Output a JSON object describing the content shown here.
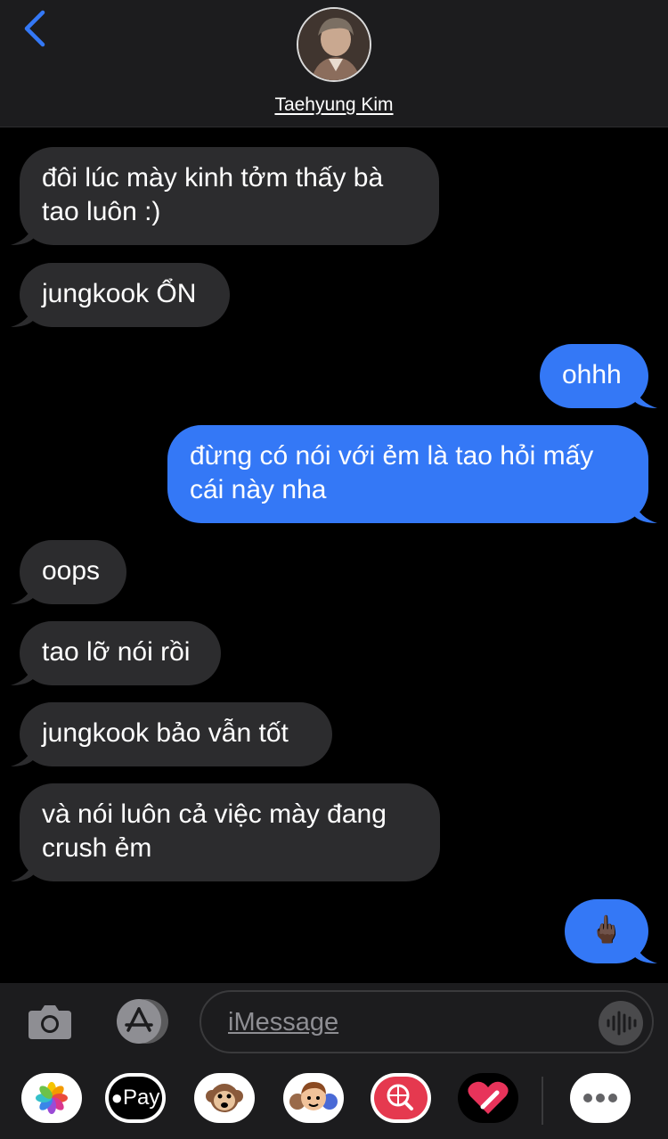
{
  "header": {
    "contact_name": "Taehyung Kim"
  },
  "messages": [
    {
      "from": "them",
      "text": "đôi lúc mày kinh tởm thấy bà tao luôn :)"
    },
    {
      "from": "them",
      "text": "jungkook ỔN"
    },
    {
      "from": "me",
      "text": "ohhh"
    },
    {
      "from": "me",
      "text": "đừng có nói với ẻm là tao hỏi mấy cái này nha"
    },
    {
      "from": "them",
      "text": "oops"
    },
    {
      "from": "them",
      "text": "tao lỡ nói rồi"
    },
    {
      "from": "them",
      "text": "jungkook bảo vẫn tốt"
    },
    {
      "from": "them",
      "text": "và nói luôn cả việc mày đang crush ẻm"
    },
    {
      "from": "me",
      "text": "🖕🏿"
    }
  ],
  "input": {
    "placeholder": "iMessage"
  },
  "app_drawer": {
    "apple_pay_label": "Pay",
    "items": [
      "photos-icon",
      "apple-pay-icon",
      "monkey-memoji-icon",
      "memoji-stickers-icon",
      "web-images-icon",
      "digital-touch-icon",
      "more-icon"
    ]
  },
  "colors": {
    "sent_bubble": "#3478f6",
    "received_bubble": "#2c2c2e",
    "accent": "#3478f6",
    "background": "#000000"
  }
}
